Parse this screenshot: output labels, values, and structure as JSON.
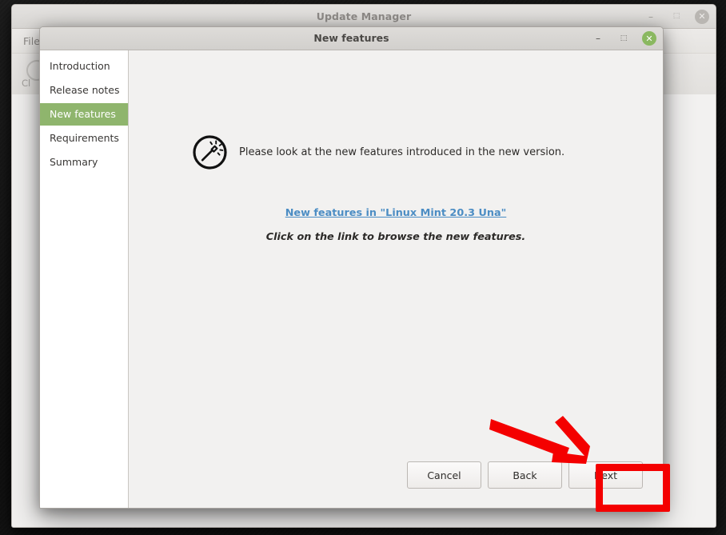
{
  "background_window": {
    "title": "Update Manager",
    "menu": [
      {
        "label": "File"
      }
    ],
    "toolbar_label": "Cl",
    "controls": {
      "minimize": "–",
      "maximize": "⬚",
      "close": "✕"
    }
  },
  "dialog": {
    "title": "New features",
    "controls": {
      "minimize": "–",
      "maximize": "⬚",
      "close": "✕"
    },
    "sidebar": {
      "items": [
        {
          "label": "Introduction",
          "active": false
        },
        {
          "label": "Release notes",
          "active": false
        },
        {
          "label": "New features",
          "active": true
        },
        {
          "label": "Requirements",
          "active": false
        },
        {
          "label": "Summary",
          "active": false
        }
      ]
    },
    "content": {
      "icon": "magic-wand-icon",
      "intro_text": "Please look at the new features introduced in the new version.",
      "link_text": "New features in \"Linux Mint 20.3 Una\"",
      "note_text": "Click on the link to browse the new features."
    },
    "footer": {
      "cancel_label": "Cancel",
      "back_label": "Back",
      "next_label": "Next"
    }
  },
  "annotations": {
    "highlight_color": "#f40000",
    "arrow_color": "#f40000",
    "target": "Next"
  },
  "colors": {
    "sidebar_active": "#8fb56d",
    "link": "#4c8dc4",
    "close_active": "#8ab860",
    "window_bg": "#f2f1f0"
  }
}
